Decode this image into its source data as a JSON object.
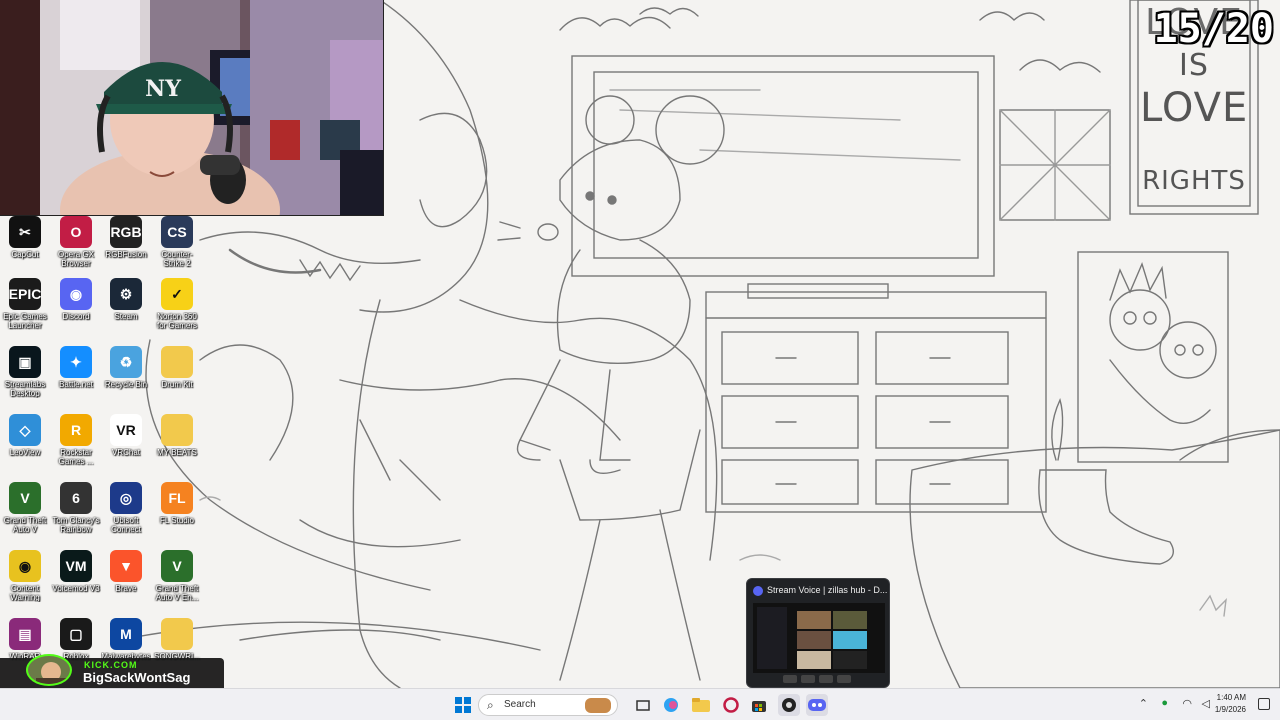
{
  "overlay": {
    "counter": "15/20"
  },
  "poster": {
    "line1": "LOVE",
    "line2": "IS",
    "line3": "LOVE",
    "line4": "RIGHTS"
  },
  "webcam": {
    "cap_letters": "NY"
  },
  "desktop_icons": [
    {
      "label": "CapCut",
      "glyph": "✂",
      "color": "#111111"
    },
    {
      "label": "Opera GX Browser",
      "glyph": "O",
      "color": "#c21d45"
    },
    {
      "label": "RGBFusion",
      "glyph": "RGB",
      "color": "#222222"
    },
    {
      "label": "Counter-Strike 2",
      "glyph": "CS",
      "color": "#2a3a5a"
    },
    {
      "label": "Epic Games Launcher",
      "glyph": "EPIC",
      "color": "#1b1b1b"
    },
    {
      "label": "Discord",
      "glyph": "◉",
      "color": "#5865f2"
    },
    {
      "label": "Steam",
      "glyph": "⚙",
      "color": "#1b2838"
    },
    {
      "label": "Norton 360 for Gamers",
      "glyph": "✓",
      "color": "#f7d117"
    },
    {
      "label": "Streamlabs Desktop",
      "glyph": "▣",
      "color": "#09161d"
    },
    {
      "label": "Battle.net",
      "glyph": "✦",
      "color": "#148eff"
    },
    {
      "label": "Recycle Bin",
      "glyph": "♻",
      "color": "#4aa3df"
    },
    {
      "label": "Drum Kit",
      "glyph": "",
      "color": "#f2c94c"
    },
    {
      "label": "LeoView",
      "glyph": "◇",
      "color": "#2f8fd8"
    },
    {
      "label": "Rockstar Games ...",
      "glyph": "R",
      "color": "#f2a900"
    },
    {
      "label": "VRChat",
      "glyph": "VR",
      "color": "#ffffff"
    },
    {
      "label": "MY BEATS",
      "glyph": "",
      "color": "#f2c94c"
    },
    {
      "label": "Grand Theft Auto V",
      "glyph": "V",
      "color": "#2b6f2b"
    },
    {
      "label": "Tom Clancy's Rainbow Six...",
      "glyph": "6",
      "color": "#333333"
    },
    {
      "label": "Ubisoft Connect",
      "glyph": "◎",
      "color": "#1d3a8a"
    },
    {
      "label": "FL Studio",
      "glyph": "FL",
      "color": "#f58220"
    },
    {
      "label": "Content Warning",
      "glyph": "◉",
      "color": "#e8c21f"
    },
    {
      "label": "Voicemod V3",
      "glyph": "VM",
      "color": "#0a1a1a"
    },
    {
      "label": "Brave",
      "glyph": "▼",
      "color": "#fb542b"
    },
    {
      "label": "Grand Theft Auto V En...",
      "glyph": "V",
      "color": "#2b6f2b"
    },
    {
      "label": "WinRAR",
      "glyph": "▤",
      "color": "#8a2a7a"
    },
    {
      "label": "Roblox",
      "glyph": "▢",
      "color": "#1a1a1a"
    },
    {
      "label": "Malwarebytes",
      "glyph": "M",
      "color": "#0d47a1"
    },
    {
      "label": "SONGWRI...",
      "glyph": "",
      "color": "#f2c94c"
    }
  ],
  "kick": {
    "site": "KICK.COM",
    "username": "BigSackWontSag"
  },
  "popup": {
    "title": "Stream Voice | zillas hub - D..."
  },
  "taskbar": {
    "search_label": "Search",
    "clock_time": "1:40 AM",
    "clock_date": "1/9/2026",
    "colors": {
      "windows": "#0078d4",
      "opera": "#c21d45",
      "discord": "#5865f2"
    }
  }
}
